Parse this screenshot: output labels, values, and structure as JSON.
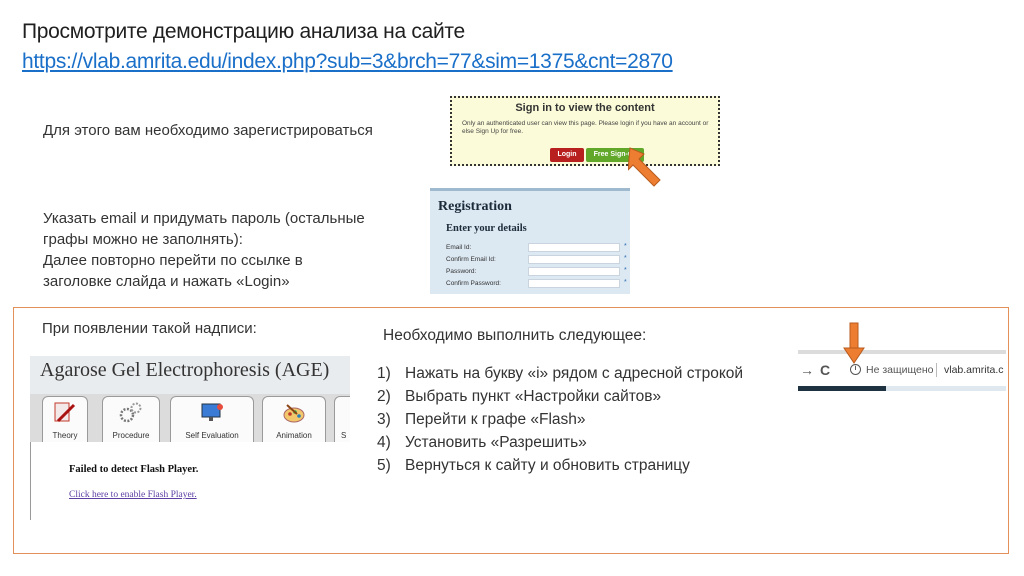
{
  "header": {
    "title": "Просмотрите демонстрацию анализа на сайте",
    "link": "https://vlab.amrita.edu/index.php?sub=3&brch=77&sim=1375&cnt=2870"
  },
  "note_register": "Для этого вам необходимо зарегистрироваться",
  "instructions": [
    "Указать email и придумать пароль (остальные",
    "графы можно не заполнять):",
    "Далее повторно перейти по ссылке в",
    "заголовке слайда и нажать «Login»"
  ],
  "signin_box": {
    "title": "Sign in to view the content",
    "text": "Only an authenticated user can view this page. Please login if you have an account or else Sign Up for free.",
    "login_label": "Login",
    "signup_label": "Free Sign-up"
  },
  "registration": {
    "title": "Registration",
    "subtitle": "Enter your details",
    "fields": [
      "Email Id:",
      "Confirm Email Id:",
      "Password:",
      "Confirm Password:"
    ],
    "required_mark": "*"
  },
  "flash_section": {
    "label": "При появлении такой надписи:",
    "need_text": "Необходимо выполнить следующее:",
    "steps": [
      {
        "num": "1)",
        "text": "Нажать на букву «i» рядом с адресной строкой"
      },
      {
        "num": "2)",
        "text": "Выбрать пункт «Настройки сайтов»"
      },
      {
        "num": "3)",
        "text": "Перейти к графе «Flash»"
      },
      {
        "num": "4)",
        "text": "Установить «Разрешить»"
      },
      {
        "num": "5)",
        "text": "Вернуться к сайту и обновить страницу"
      }
    ]
  },
  "age_panel": {
    "title": "Agarose Gel Electrophoresis (AGE)",
    "tabs": [
      "Theory",
      "Procedure",
      "Self Evaluation",
      "Animation",
      "S"
    ],
    "fail_text": "Failed to detect Flash Player.",
    "link_text": "Click here to enable Flash Player."
  },
  "browser": {
    "back": "→",
    "reload": "C",
    "info": "i",
    "insecure_text": "Не защищено",
    "url": "vlab.amrita.c"
  },
  "colors": {
    "accent_orange": "#e3905b",
    "link_blue": "#1a6fc9",
    "login_red": "#b81f1f",
    "signup_green": "#61a82a"
  }
}
